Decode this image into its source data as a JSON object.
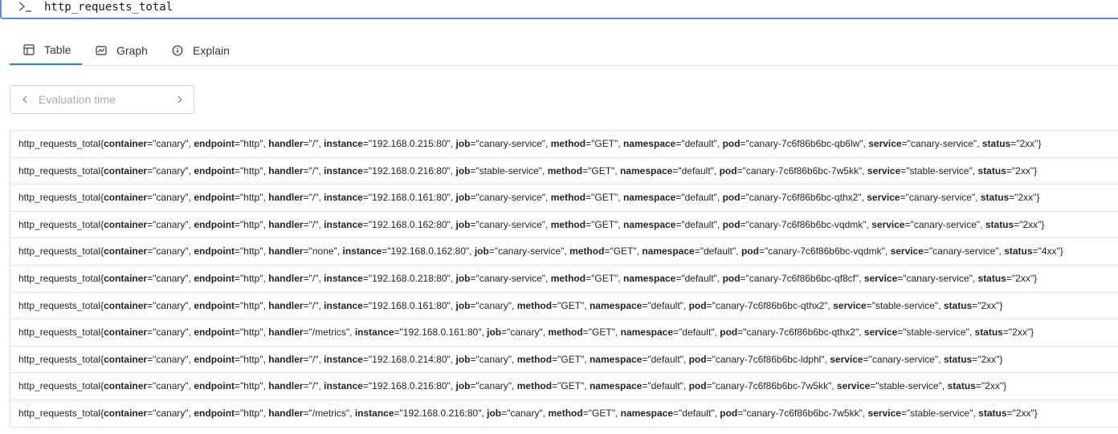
{
  "query": {
    "text": "http_requests_total"
  },
  "tabs": [
    {
      "label": "Table",
      "icon": "table-icon",
      "active": true
    },
    {
      "label": "Graph",
      "icon": "graph-icon",
      "active": false
    },
    {
      "label": "Explain",
      "icon": "info-icon",
      "active": false
    }
  ],
  "evaluation": {
    "placeholder": "Evaluation time"
  },
  "accent_color": "#3b82c4",
  "results": [
    {
      "metric": "http_requests_total",
      "labels": [
        [
          "container",
          "canary"
        ],
        [
          "endpoint",
          "http"
        ],
        [
          "handler",
          "/"
        ],
        [
          "instance",
          "192.168.0.215:80"
        ],
        [
          "job",
          "canary-service"
        ],
        [
          "method",
          "GET"
        ],
        [
          "namespace",
          "default"
        ],
        [
          "pod",
          "canary-7c6f86b6bc-qb6lw"
        ],
        [
          "service",
          "canary-service"
        ],
        [
          "status",
          "2xx"
        ]
      ]
    },
    {
      "metric": "http_requests_total",
      "labels": [
        [
          "container",
          "canary"
        ],
        [
          "endpoint",
          "http"
        ],
        [
          "handler",
          "/"
        ],
        [
          "instance",
          "192.168.0.216:80"
        ],
        [
          "job",
          "stable-service"
        ],
        [
          "method",
          "GET"
        ],
        [
          "namespace",
          "default"
        ],
        [
          "pod",
          "canary-7c6f86b6bc-7w5kk"
        ],
        [
          "service",
          "stable-service"
        ],
        [
          "status",
          "2xx"
        ]
      ]
    },
    {
      "metric": "http_requests_total",
      "labels": [
        [
          "container",
          "canary"
        ],
        [
          "endpoint",
          "http"
        ],
        [
          "handler",
          "/"
        ],
        [
          "instance",
          "192.168.0.161:80"
        ],
        [
          "job",
          "canary-service"
        ],
        [
          "method",
          "GET"
        ],
        [
          "namespace",
          "default"
        ],
        [
          "pod",
          "canary-7c6f86b6bc-qthx2"
        ],
        [
          "service",
          "canary-service"
        ],
        [
          "status",
          "2xx"
        ]
      ]
    },
    {
      "metric": "http_requests_total",
      "labels": [
        [
          "container",
          "canary"
        ],
        [
          "endpoint",
          "http"
        ],
        [
          "handler",
          "/"
        ],
        [
          "instance",
          "192.168.0.162:80"
        ],
        [
          "job",
          "canary-service"
        ],
        [
          "method",
          "GET"
        ],
        [
          "namespace",
          "default"
        ],
        [
          "pod",
          "canary-7c6f86b6bc-vqdmk"
        ],
        [
          "service",
          "canary-service"
        ],
        [
          "status",
          "2xx"
        ]
      ]
    },
    {
      "metric": "http_requests_total",
      "labels": [
        [
          "container",
          "canary"
        ],
        [
          "endpoint",
          "http"
        ],
        [
          "handler",
          "none"
        ],
        [
          "instance",
          "192.168.0.162:80"
        ],
        [
          "job",
          "canary-service"
        ],
        [
          "method",
          "GET"
        ],
        [
          "namespace",
          "default"
        ],
        [
          "pod",
          "canary-7c6f86b6bc-vqdmk"
        ],
        [
          "service",
          "canary-service"
        ],
        [
          "status",
          "4xx"
        ]
      ]
    },
    {
      "metric": "http_requests_total",
      "labels": [
        [
          "container",
          "canary"
        ],
        [
          "endpoint",
          "http"
        ],
        [
          "handler",
          "/"
        ],
        [
          "instance",
          "192.168.0.218:80"
        ],
        [
          "job",
          "canary-service"
        ],
        [
          "method",
          "GET"
        ],
        [
          "namespace",
          "default"
        ],
        [
          "pod",
          "canary-7c6f86b6bc-qf8cf"
        ],
        [
          "service",
          "canary-service"
        ],
        [
          "status",
          "2xx"
        ]
      ]
    },
    {
      "metric": "http_requests_total",
      "labels": [
        [
          "container",
          "canary"
        ],
        [
          "endpoint",
          "http"
        ],
        [
          "handler",
          "/"
        ],
        [
          "instance",
          "192.168.0.161:80"
        ],
        [
          "job",
          "canary"
        ],
        [
          "method",
          "GET"
        ],
        [
          "namespace",
          "default"
        ],
        [
          "pod",
          "canary-7c6f86b6bc-qthx2"
        ],
        [
          "service",
          "stable-service"
        ],
        [
          "status",
          "2xx"
        ]
      ]
    },
    {
      "metric": "http_requests_total",
      "labels": [
        [
          "container",
          "canary"
        ],
        [
          "endpoint",
          "http"
        ],
        [
          "handler",
          "/metrics"
        ],
        [
          "instance",
          "192.168.0.161:80"
        ],
        [
          "job",
          "canary"
        ],
        [
          "method",
          "GET"
        ],
        [
          "namespace",
          "default"
        ],
        [
          "pod",
          "canary-7c6f86b6bc-qthx2"
        ],
        [
          "service",
          "stable-service"
        ],
        [
          "status",
          "2xx"
        ]
      ]
    },
    {
      "metric": "http_requests_total",
      "labels": [
        [
          "container",
          "canary"
        ],
        [
          "endpoint",
          "http"
        ],
        [
          "handler",
          "/"
        ],
        [
          "instance",
          "192.168.0.214:80"
        ],
        [
          "job",
          "canary"
        ],
        [
          "method",
          "GET"
        ],
        [
          "namespace",
          "default"
        ],
        [
          "pod",
          "canary-7c6f86b6bc-ldphl"
        ],
        [
          "service",
          "canary-service"
        ],
        [
          "status",
          "2xx"
        ]
      ]
    },
    {
      "metric": "http_requests_total",
      "labels": [
        [
          "container",
          "canary"
        ],
        [
          "endpoint",
          "http"
        ],
        [
          "handler",
          "/"
        ],
        [
          "instance",
          "192.168.0.216:80"
        ],
        [
          "job",
          "canary"
        ],
        [
          "method",
          "GET"
        ],
        [
          "namespace",
          "default"
        ],
        [
          "pod",
          "canary-7c6f86b6bc-7w5kk"
        ],
        [
          "service",
          "stable-service"
        ],
        [
          "status",
          "2xx"
        ]
      ]
    },
    {
      "metric": "http_requests_total",
      "labels": [
        [
          "container",
          "canary"
        ],
        [
          "endpoint",
          "http"
        ],
        [
          "handler",
          "/metrics"
        ],
        [
          "instance",
          "192.168.0.216:80"
        ],
        [
          "job",
          "canary"
        ],
        [
          "method",
          "GET"
        ],
        [
          "namespace",
          "default"
        ],
        [
          "pod",
          "canary-7c6f86b6bc-7w5kk"
        ],
        [
          "service",
          "stable-service"
        ],
        [
          "status",
          "2xx"
        ]
      ]
    }
  ]
}
